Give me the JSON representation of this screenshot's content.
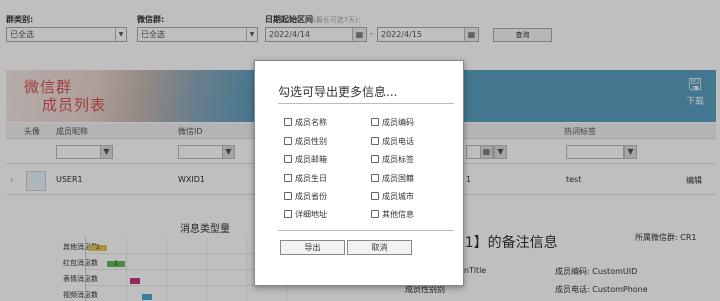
{
  "filters": {
    "group_type_label": "群类别:",
    "group_type_value": "已全选",
    "wechat_group_label": "微信群:",
    "wechat_group_value": "已全选",
    "date_label": "日期起始区间",
    "date_hint": "(最长可选7天):",
    "date_start": "2022/4/14",
    "date_sep": "-",
    "date_end": "2022/4/15",
    "query_button": "查询"
  },
  "banner": {
    "title_line1": "微信群",
    "title_line2": "成员列表",
    "download_label": "下载"
  },
  "table": {
    "headers": {
      "avatar": "头像",
      "nickname": "成员昵称",
      "wechat_id": "微信ID",
      "tags": "热词标签"
    },
    "row": {
      "nickname": "USER1",
      "wechat_id": "WXID1",
      "col_mid": "1",
      "tag": "test",
      "edit": "编辑"
    }
  },
  "chart": {
    "title": "消息类型量",
    "categories": [
      "其他消息数",
      "红包消息数",
      "表情消息数",
      "视频消息数"
    ],
    "bar_labels": [
      "2",
      "2",
      "",
      ""
    ]
  },
  "chart_data": {
    "type": "bar",
    "title": "消息类型量",
    "categories": [
      "其他消息数",
      "红包消息数",
      "表情消息数",
      "视频消息数"
    ],
    "values": [
      2,
      2,
      null,
      null
    ]
  },
  "note": {
    "title_visible": "R1】的备注信息",
    "group_label": "所属微信群: CR1",
    "field_title": "nTitle",
    "field_uid": "成员编码: CustomUID",
    "field_phone": "成员电话: CustomPhone",
    "field_partial": "成员性别别"
  },
  "modal": {
    "title": "勾选可导出更多信息...",
    "options": [
      {
        "label": "成员名称",
        "checked": false
      },
      {
        "label": "成员编码",
        "checked": false
      },
      {
        "label": "成员性别",
        "checked": false
      },
      {
        "label": "成员电话",
        "checked": false
      },
      {
        "label": "成员邮箱",
        "checked": false
      },
      {
        "label": "成员标签",
        "checked": false
      },
      {
        "label": "成员生日",
        "checked": false
      },
      {
        "label": "成员国籍",
        "checked": false
      },
      {
        "label": "成员省份",
        "checked": false
      },
      {
        "label": "成员城市",
        "checked": false
      },
      {
        "label": "详细地址",
        "checked": false
      },
      {
        "label": "其他信息",
        "checked": false
      }
    ],
    "export_button": "导出",
    "cancel_button": "取消"
  },
  "colors": {
    "banner_bg": "#5a9fc0",
    "banner_title": "#d9534f",
    "bar1": "#e8c34a",
    "bar2": "#5cb85c",
    "bar3": "#c0397a",
    "bar4": "#4aa8c9"
  }
}
